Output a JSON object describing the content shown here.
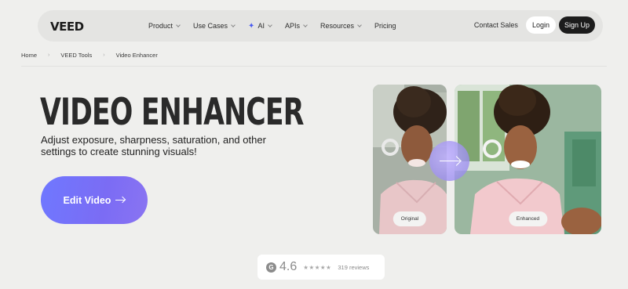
{
  "nav": {
    "logo": "VEED",
    "items": [
      {
        "label": "Product",
        "dropdown": true
      },
      {
        "label": "Use Cases",
        "dropdown": true
      },
      {
        "label": "AI",
        "dropdown": true,
        "icon": "sparkle-icon"
      },
      {
        "label": "APIs",
        "dropdown": true
      },
      {
        "label": "Resources",
        "dropdown": true
      },
      {
        "label": "Pricing",
        "dropdown": false
      }
    ],
    "contact": "Contact Sales",
    "login": "Login",
    "signup": "Sign Up"
  },
  "breadcrumb": [
    "Home",
    "VEED Tools",
    "Video Enhancer"
  ],
  "hero": {
    "title": "VIDEO ENHANCER",
    "subtitle": "Adjust exposure, sharpness, saturation, and other settings to create stunning visuals!",
    "cta": "Edit Video"
  },
  "comparison": {
    "original_label": "Original",
    "enhanced_label": "Enhanced"
  },
  "rating": {
    "icon": "g2-icon",
    "icon_text": "G",
    "score": "4.6",
    "stars": "★★★★★",
    "reviews": "319 reviews"
  },
  "colors": {
    "background": "#efefed",
    "nav_bg": "#e4e4e2",
    "cta_gradient_start": "#6f78ff",
    "cta_gradient_end": "#8a74f2",
    "signup_bg": "#1c1c1c"
  }
}
